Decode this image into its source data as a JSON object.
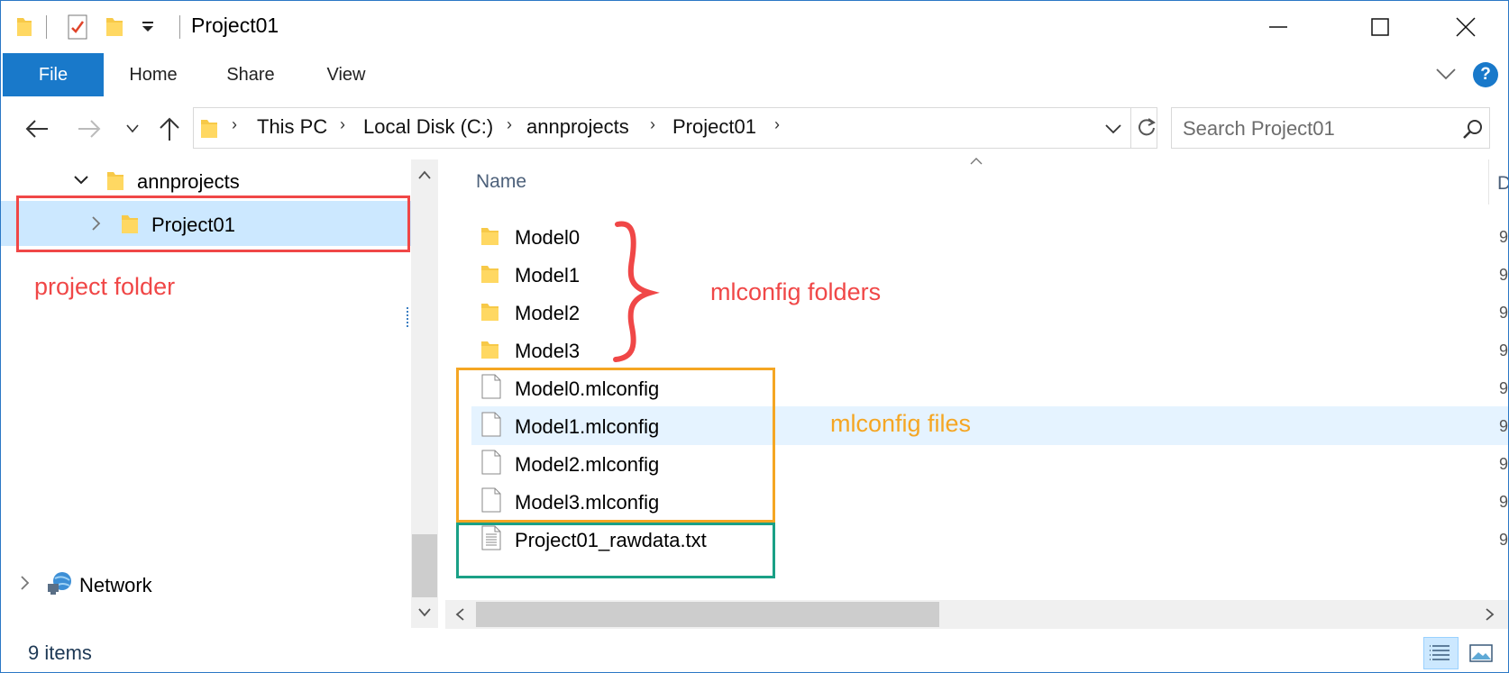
{
  "window": {
    "title": "Project01",
    "controls": {
      "minimize": "minimize",
      "maximize": "maximize",
      "close": "close"
    }
  },
  "ribbon": {
    "tabs": [
      "File",
      "Home",
      "Share",
      "View"
    ],
    "help": "?"
  },
  "address_bar": {
    "crumbs": [
      "This PC",
      "Local Disk (C:)",
      "annprojects",
      "Project01"
    ]
  },
  "search": {
    "placeholder": "Search Project01"
  },
  "nav_tree": {
    "items": [
      {
        "label": "annprojects",
        "expanded": true
      },
      {
        "label": "Project01",
        "expanded": false,
        "selected": true
      },
      {
        "label": "Network",
        "expanded": false
      }
    ]
  },
  "file_list": {
    "column_name": "Name",
    "column_next_cut": "D",
    "items": [
      {
        "name": "Model0",
        "type": "folder"
      },
      {
        "name": "Model1",
        "type": "folder"
      },
      {
        "name": "Model2",
        "type": "folder"
      },
      {
        "name": "Model3",
        "type": "folder"
      },
      {
        "name": "Model0.mlconfig",
        "type": "file"
      },
      {
        "name": "Model1.mlconfig",
        "type": "file",
        "highlighted": true
      },
      {
        "name": "Model2.mlconfig",
        "type": "file"
      },
      {
        "name": "Model3.mlconfig",
        "type": "file"
      },
      {
        "name": "Project01_rawdata.txt",
        "type": "text-file"
      }
    ],
    "cut_column_glyph": "9"
  },
  "status": {
    "item_count": "9 items"
  },
  "annotations": {
    "project_folder": "project folder",
    "mlconfig_folders": "mlconfig folders",
    "mlconfig_files": "mlconfig files",
    "colors": {
      "red": "#f04747",
      "orange": "#f5a623",
      "teal": "#1aa086"
    }
  },
  "colors": {
    "accent": "#1979ca",
    "selection": "#cce8ff",
    "hover": "#e5f3ff"
  }
}
